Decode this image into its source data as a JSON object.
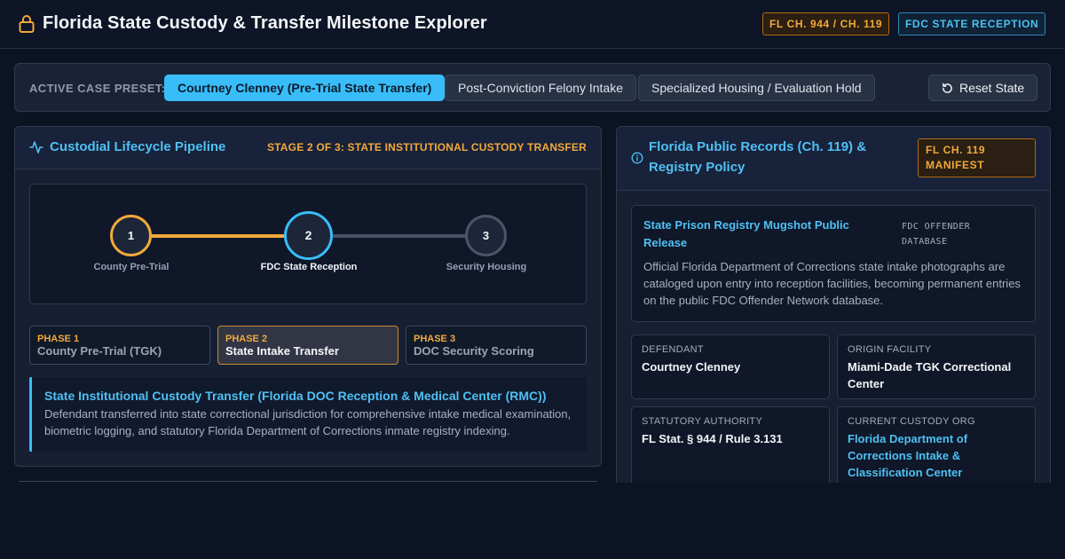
{
  "header": {
    "title": "Florida State Custody & Transfer Milestone Explorer",
    "badges": [
      "FL CH. 944 / CH. 119",
      "FDC STATE RECEPTION"
    ]
  },
  "presets": {
    "label": "ACTIVE CASE PRESET:",
    "items": [
      "Courtney Clenney (Pre-Trial State Transfer)",
      "Post-Conviction Felony Intake",
      "Specialized Housing / Evaluation Hold"
    ],
    "active_index": 0,
    "reset_label": "Reset State"
  },
  "pipeline": {
    "title": "Custodial Lifecycle Pipeline",
    "stage_label": "STAGE 2 OF 3: STATE INSTITUTIONAL CUSTODY TRANSFER",
    "current_step": 2,
    "steps": [
      {
        "number": "1",
        "caption": "County Pre-Trial"
      },
      {
        "number": "2",
        "caption": "FDC State Reception"
      },
      {
        "number": "3",
        "caption": "Security Housing"
      }
    ],
    "phases": [
      {
        "tag": "PHASE 1",
        "name": "County Pre-Trial (TGK)"
      },
      {
        "tag": "PHASE 2",
        "name": "State Intake Transfer"
      },
      {
        "tag": "PHASE 3",
        "name": "DOC Security Scoring"
      }
    ],
    "detail": {
      "title": "State Institutional Custody Transfer (Florida DOC Reception & Medical Center (RMC))",
      "body": "Defendant transferred into state correctional jurisdiction for comprehensive intake medical examination, biometric logging, and statutory Florida Department of Corrections inmate registry indexing."
    }
  },
  "records": {
    "title": "Florida Public Records (Ch. 119) & Registry Policy",
    "badge": "FL CH. 119 MANIFEST",
    "release": {
      "title": "State Prison Registry Mugshot Public Release",
      "source": "FDC OFFENDER DATABASE",
      "body": "Official Florida Department of Corrections state intake photographs are cataloged upon entry into reception facilities, becoming permanent entries on the public FDC Offender Network database."
    },
    "fields": [
      {
        "label": "DEFENDANT",
        "value": "Courtney Clenney"
      },
      {
        "label": "ORIGIN FACILITY",
        "value": "Miami-Dade TGK Correctional Center"
      },
      {
        "label": "STATUTORY AUTHORITY",
        "value": "FL Stat. § 944 / Rule 3.131"
      },
      {
        "label": "CURRENT CUSTODY ORG",
        "value": "Florida Department of Corrections Intake & Classification Center"
      }
    ]
  },
  "colors": {
    "accent_cyan": "#38bdf8",
    "accent_amber": "#f2a93b",
    "background": "#0c1322",
    "panel": "#172033"
  },
  "icons": [
    "lock-icon",
    "activity-icon",
    "info-icon",
    "refresh-icon"
  ]
}
